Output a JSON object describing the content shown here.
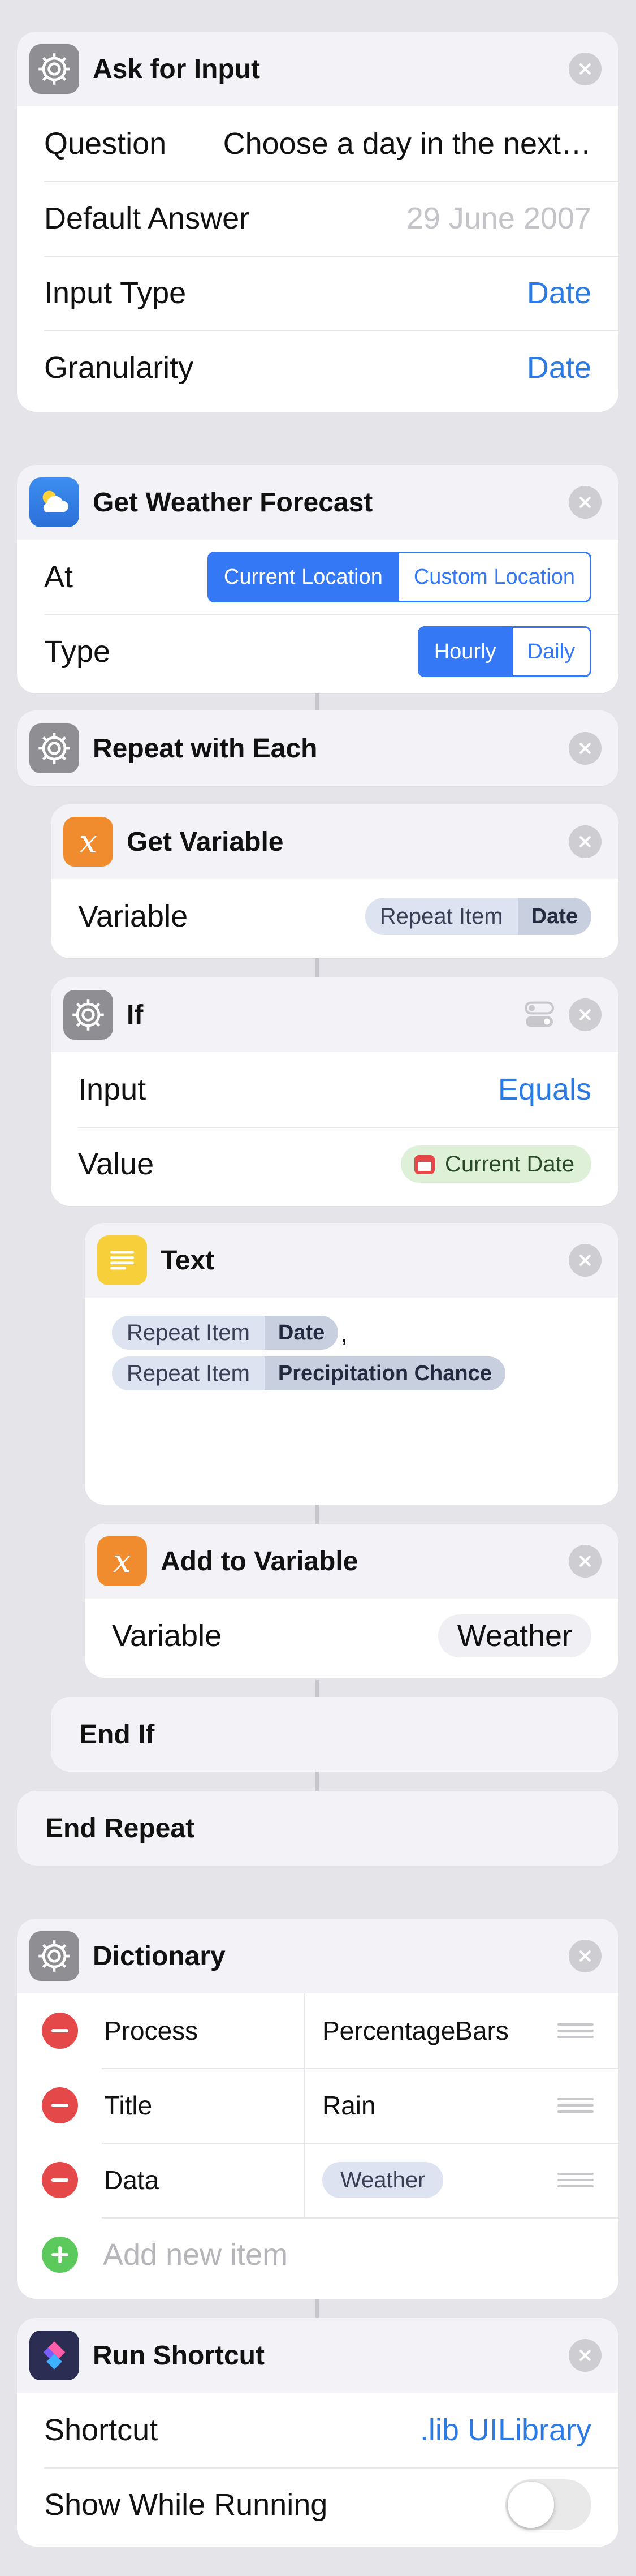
{
  "ask_for_input": {
    "title": "Ask for Input",
    "rows": [
      {
        "label": "Question",
        "value": "Choose a day in the next…"
      },
      {
        "label": "Default Answer",
        "value": "29 June 2007"
      },
      {
        "label": "Input Type",
        "value": "Date"
      },
      {
        "label": "Granularity",
        "value": "Date"
      }
    ]
  },
  "weather_forecast": {
    "title": "Get Weather Forecast",
    "at_label": "At",
    "at_options": [
      "Current Location",
      "Custom Location"
    ],
    "at_selected": "Current Location",
    "type_label": "Type",
    "type_options": [
      "Hourly",
      "Daily"
    ],
    "type_selected": "Hourly"
  },
  "repeat_each": {
    "title": "Repeat with Each"
  },
  "get_variable": {
    "title": "Get Variable",
    "label": "Variable",
    "token_name": "Repeat Item",
    "token_prop": "Date"
  },
  "if_block": {
    "title": "If",
    "input_label": "Input",
    "input_value": "Equals",
    "value_label": "Value",
    "value_token": "Current Date"
  },
  "text_block": {
    "title": "Text",
    "line1_name": "Repeat Item",
    "line1_prop": "Date",
    "line1_suffix": ",",
    "line2_name": "Repeat Item",
    "line2_prop": "Precipitation Chance"
  },
  "add_to_variable": {
    "title": "Add to Variable",
    "label": "Variable",
    "value": "Weather"
  },
  "end_if": {
    "title": "End If"
  },
  "end_repeat": {
    "title": "End Repeat"
  },
  "dictionary": {
    "title": "Dictionary",
    "items": [
      {
        "key": "Process",
        "value": "PercentageBars"
      },
      {
        "key": "Title",
        "value": "Rain"
      },
      {
        "key": "Data",
        "value": "Weather"
      }
    ],
    "add_label": "Add new item"
  },
  "run_shortcut": {
    "title": "Run Shortcut",
    "shortcut_label": "Shortcut",
    "shortcut_value": ".lib UILibrary",
    "show_label": "Show While Running",
    "show_enabled": false
  },
  "colors": {
    "accent": "#2c7be5",
    "background": "#e4e4e9",
    "variable_icon": "#f08c2e",
    "text_icon": "#f7cf3a",
    "delete": "#e54848",
    "add": "#5bc95b"
  }
}
